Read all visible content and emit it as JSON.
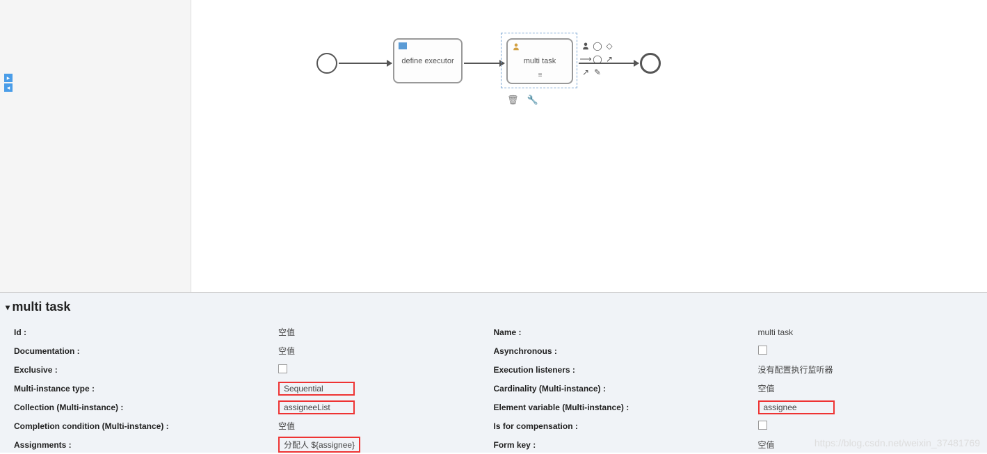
{
  "canvas": {
    "task1_label": "define executor",
    "task2_label": "multi task"
  },
  "panel": {
    "title": "multi task",
    "left": [
      {
        "label": "Id :",
        "value": "空值",
        "hl": false
      },
      {
        "label": "Documentation :",
        "value": "空值",
        "hl": false
      },
      {
        "label": "Exclusive :",
        "value": "",
        "chk": true
      },
      {
        "label": "Multi-instance type :",
        "value": "Sequential",
        "hl": true
      },
      {
        "label": "Collection (Multi-instance) :",
        "value": "assigneeList",
        "hl": true
      },
      {
        "label": "Completion condition (Multi-instance) :",
        "value": "空值",
        "hl": false
      },
      {
        "label": "Assignments :",
        "value": "分配人 ${assignee}",
        "hl": true
      }
    ],
    "right": [
      {
        "label": "Name :",
        "value": "multi task",
        "hl": false
      },
      {
        "label": "Asynchronous :",
        "value": "",
        "chk": true
      },
      {
        "label": "Execution listeners :",
        "value": "没有配置执行监听器",
        "hl": false
      },
      {
        "label": "Cardinality (Multi-instance) :",
        "value": "空值",
        "hl": false
      },
      {
        "label": "Element variable (Multi-instance) :",
        "value": "assignee",
        "hl": true
      },
      {
        "label": "Is for compensation :",
        "value": "",
        "chk": true
      },
      {
        "label": "Form key :",
        "value": "空值",
        "hl": false
      }
    ]
  },
  "watermark": "https://blog.csdn.net/weixin_37481769"
}
